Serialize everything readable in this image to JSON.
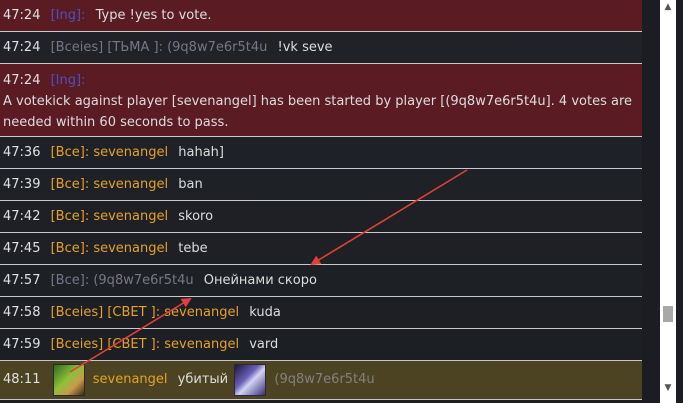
{
  "messages": [
    {
      "time": "47:24",
      "tag": "[Ing]:",
      "text": "Type !yes to vote."
    },
    {
      "time": "47:24",
      "tag": "[Bceies] [TЬMA ]: (9q8w7e6r5t4u",
      "text": "!vk seve"
    },
    {
      "time": "47:24",
      "tag": "[Ing]:",
      "line1": "A votekick against player [sevenangel] has been started by player [(9q8w7e6r5t4u]. 4 votes are",
      "line2": "needed within 60 seconds to pass."
    },
    {
      "time": "47:36",
      "tag": "[Bce]:",
      "name": "sevenangel",
      "text": "hahah]"
    },
    {
      "time": "47:39",
      "tag": "[Bce]:",
      "name": "sevenangel",
      "text": "ban"
    },
    {
      "time": "47:42",
      "tag": "[Bce]:",
      "name": "sevenangel",
      "text": "skoro"
    },
    {
      "time": "47:45",
      "tag": "[Bce]:",
      "name": "sevenangel",
      "text": "tebe"
    },
    {
      "time": "47:57",
      "tag": "[Bce]:",
      "name": "(9q8w7e6r5t4u",
      "text": "Онейнами скоро"
    },
    {
      "time": "47:58",
      "tag": "[Bceies] [CBET ]:",
      "name": "sevenangel",
      "text": "kuda"
    },
    {
      "time": "47:59",
      "tag": "[Bceies] [CBET ]:",
      "name": "sevenangel",
      "text": "vard"
    }
  ],
  "kill": {
    "time": "48:11",
    "killer": "sevenangel",
    "verb": "убитый",
    "victim": "(9q8w7e6r5t4u"
  },
  "scrollbar": {
    "up": "▲",
    "down": "▼"
  },
  "colors": {
    "system_row": "#5a1c22",
    "kill_row": "#4b4322",
    "arrow": "#e0403a",
    "orange": "#e6a22a"
  }
}
